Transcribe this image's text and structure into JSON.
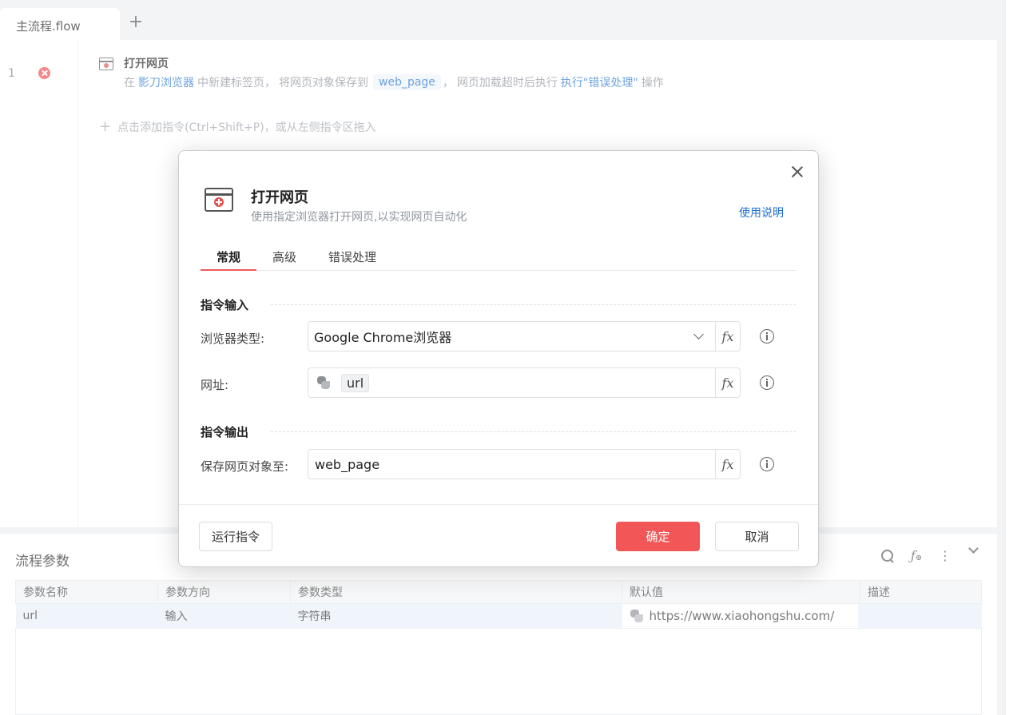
{
  "tabs": {
    "active_label": "主流程.flow",
    "add_symbol": "+"
  },
  "editor": {
    "line_number": "1",
    "command": {
      "title": "打开网页",
      "desc_1": "在",
      "desc_browser": "影刀浏览器",
      "desc_2": "中新建标签页，",
      "desc_3": "将网页对象保存到",
      "desc_var": "web_page",
      "desc_4": "，",
      "desc_5": "网页加载超时后执行",
      "desc_action": "执行\"错误处理\"",
      "desc_6": "操作"
    },
    "add_hint": "点击添加指令(Ctrl+Shift+P)，或从左侧指令区拖入",
    "add_hint_symbol": "+"
  },
  "modal": {
    "title": "打开网页",
    "subtitle": "使用指定浏览器打开网页,以实现网页自动化",
    "help_link": "使用说明",
    "tabs": [
      "常规",
      "高级",
      "错误处理"
    ],
    "section_input": "指令输入",
    "section_output": "指令输出",
    "browser_label": "浏览器类型:",
    "browser_value": "Google Chrome浏览器",
    "url_label": "网址:",
    "url_value": "url",
    "save_label": "保存网页对象至:",
    "save_value": "web_page",
    "fx_label": "fx",
    "run_button": "运行指令",
    "ok_button": "确定",
    "cancel_button": "取消"
  },
  "params_panel": {
    "title": "流程参数",
    "more_symbol": "⋮",
    "columns": [
      "参数名称",
      "参数方向",
      "参数类型",
      "默认值",
      "描述"
    ],
    "row": {
      "name": "url",
      "direction": "输入",
      "type": "字符串",
      "default": "https://www.xiaohongshu.com/",
      "desc": ""
    }
  },
  "colors": {
    "accent": "#f25656",
    "link": "#1f6fd1",
    "error": "#f0484b"
  }
}
